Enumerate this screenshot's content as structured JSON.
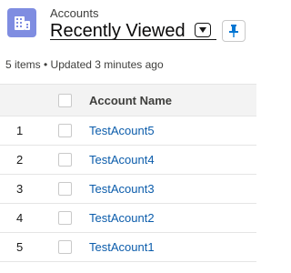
{
  "header": {
    "object_label": "Accounts",
    "list_view_title": "Recently Viewed",
    "icon": "accounts-icon",
    "dropdown_icon": "caret-down-icon",
    "pin_icon": "pin-icon",
    "meta_text": "5 items • Updated 3 minutes ago"
  },
  "table": {
    "columns": [
      "",
      "",
      "Account Name"
    ],
    "rows": [
      {
        "num": "1",
        "name": "TestAcount5"
      },
      {
        "num": "2",
        "name": "TestAcount4"
      },
      {
        "num": "3",
        "name": "TestAcount3"
      },
      {
        "num": "4",
        "name": "TestAcount2"
      },
      {
        "num": "5",
        "name": "TestAcount1"
      }
    ]
  },
  "colors": {
    "icon_bg": "#7f8de1",
    "link": "#0b5cab",
    "pin": "#0176d3",
    "header_bg": "#f3f3f3"
  }
}
